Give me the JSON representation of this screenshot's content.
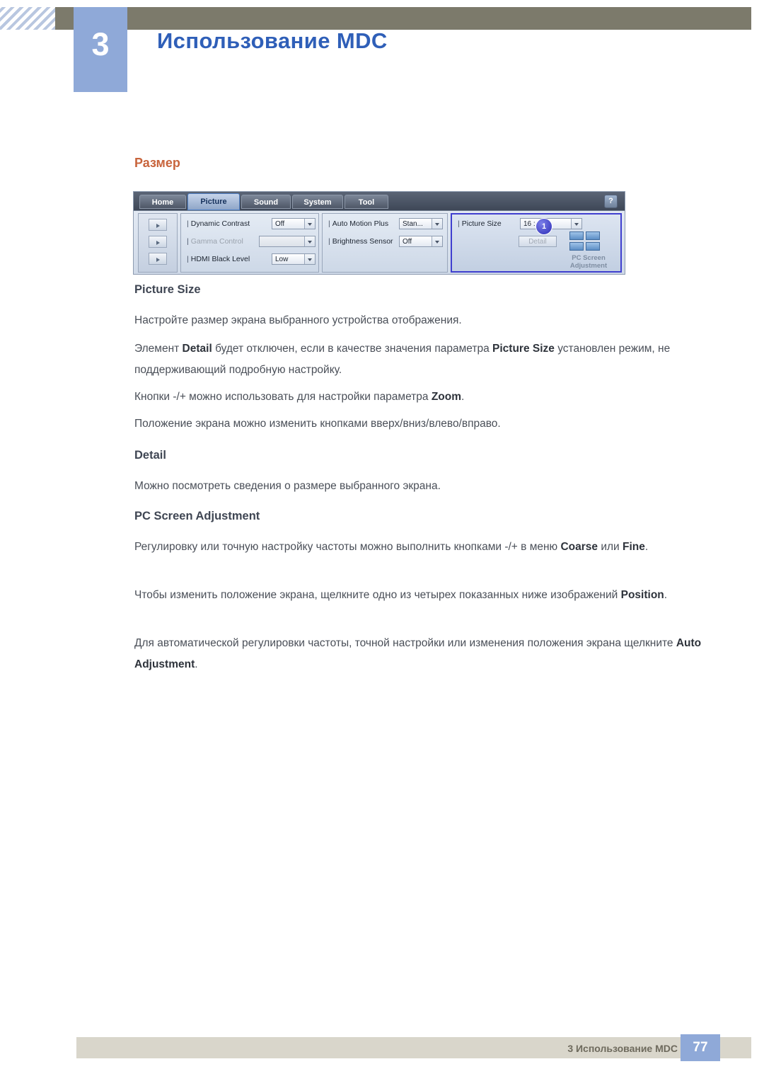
{
  "header": {
    "chapter_number": "3",
    "title": "Использование MDC"
  },
  "section": {
    "title": "Размер"
  },
  "mdc": {
    "tabs": [
      {
        "label": "Home",
        "active": false
      },
      {
        "label": "Picture",
        "active": true
      },
      {
        "label": "Sound",
        "active": false
      },
      {
        "label": "System",
        "active": false
      },
      {
        "label": "Tool",
        "active": false
      }
    ],
    "help_label": "?",
    "panel_a": {
      "rows": [
        {
          "label": "Dynamic Contrast",
          "value": "Off"
        },
        {
          "label": "Gamma Control",
          "value": ""
        },
        {
          "label": "HDMI Black Level",
          "value": "Low"
        }
      ]
    },
    "panel_b": {
      "rows": [
        {
          "label": "Auto Motion Plus",
          "value": "Stan..."
        },
        {
          "label": "Brightness Sensor",
          "value": "Off"
        }
      ]
    },
    "panel_c": {
      "row": {
        "label": "Picture Size",
        "value": "16 : 9"
      },
      "detail_button": "Detail",
      "badge": "1",
      "pc_screen_label_line1": "PC Screen",
      "pc_screen_label_line2": "Adjustment"
    }
  },
  "body": {
    "picture_size_heading": "Picture Size",
    "picture_size_p1": "Настройте размер экрана выбранного устройства отображения.",
    "picture_size_p2_a": "Элемент ",
    "picture_size_p2_b": "Detail",
    "picture_size_p2_c": " будет отключен, если в качестве значения параметра ",
    "picture_size_p2_d": "Picture Size",
    "picture_size_p2_e": " установлен режим, не поддерживающий подробную настройку.",
    "picture_size_p3_a": "Кнопки -/+ можно использовать для настройки параметра ",
    "picture_size_p3_b": "Zoom",
    "picture_size_p3_c": ".",
    "picture_size_p4": "Положение экрана можно изменить кнопками вверх/вниз/влево/вправо.",
    "detail_heading": "Detail",
    "detail_p1": "Можно посмотреть сведения о размере выбранного экрана.",
    "pcsa_heading": "PC Screen Adjustment",
    "pcsa_p1_a": "Регулировку или точную настройку частоты можно выполнить кнопками -/+ в меню ",
    "pcsa_p1_b": "Coarse",
    "pcsa_p1_c": " или ",
    "pcsa_p1_d": "Fine",
    "pcsa_p1_e": ".",
    "pcsa_p2_a": "Чтобы изменить положение экрана, щелкните одно из четырех показанных ниже изображений ",
    "pcsa_p2_b": "Position",
    "pcsa_p2_c": ".",
    "pcsa_p3_a": "Для автоматической регулировки частоты, точной настройки или изменения положения экрана щелкните ",
    "pcsa_p3_b": "Auto Adjustment",
    "pcsa_p3_c": "."
  },
  "footer": {
    "text": "3 Использование MDC",
    "page": "77"
  }
}
